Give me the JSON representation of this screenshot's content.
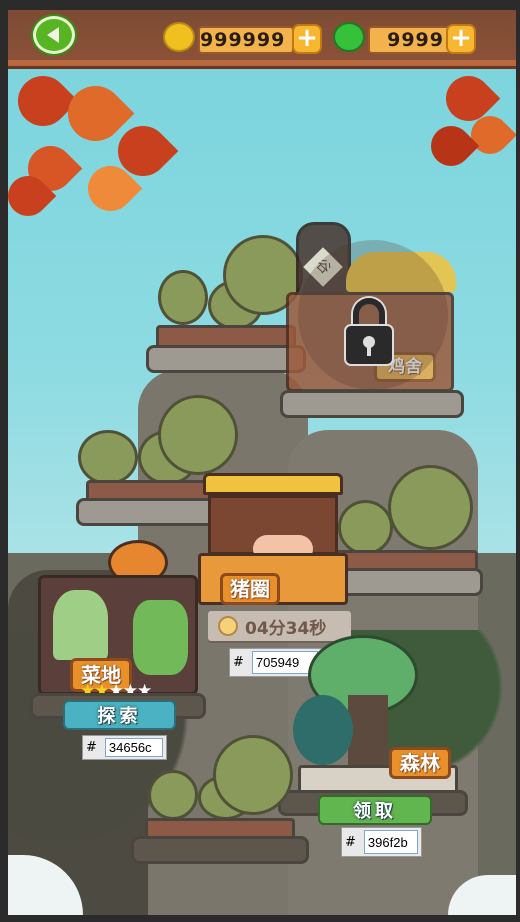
{
  "header": {
    "back_icon": "back-arrow-icon",
    "coins": {
      "icon": "gold-coin-icon",
      "value": "999999",
      "add": "+"
    },
    "jade": {
      "icon": "jade-icon",
      "value": "9999",
      "add": "+"
    }
  },
  "buildings": {
    "coop": {
      "label": "鸡舍",
      "jar_label": "谷",
      "locked": true,
      "lock_icon": "lock-icon"
    },
    "pigpen": {
      "label": "猪圈",
      "timer": "04分34秒",
      "hex_label": "#",
      "hex_value": "705949"
    },
    "field": {
      "label": "菜地",
      "stars_filled": 2,
      "stars_total": 5,
      "button": "探索",
      "hex_label": "#",
      "hex_value": "34656c"
    },
    "forest": {
      "label": "森林",
      "button": "领取",
      "hex_label": "#",
      "hex_value": "396f2b"
    }
  },
  "colors": {
    "explore": "#34656c",
    "claim": "#396f2b",
    "timer": "#705949"
  }
}
